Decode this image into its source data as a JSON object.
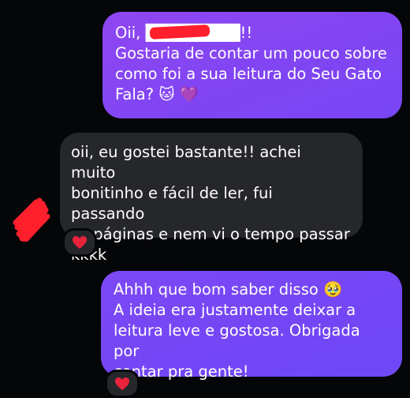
{
  "messages": [
    {
      "sender": "me",
      "text": "Oii, ████████!!\nGostaria de contar um pouco sobre\ncomo foi a sua leitura do Seu Gato\nFala? 🐱 💜"
    },
    {
      "sender": "them",
      "text": "oii, eu gostei bastante!! achei muito\nbonitinho e fácil de ler, fui passando\nas páginas e nem vi o tempo passar\nkkkk",
      "reaction": "❤️"
    },
    {
      "sender": "me",
      "text": "Ahhh que bom saber disso 🥹\nA ideia era justamente deixar a\nleitura leve e gostosa. Obrigada por\ncontar pra gente!",
      "reaction": "❤️"
    }
  ],
  "colors": {
    "background": "#050608",
    "outgoing_bubble": "#8145f3",
    "incoming_bubble": "#26272b",
    "redaction": "#ff1f2d",
    "heart": "#e8233b"
  },
  "icons": [
    "heart-reaction-icon",
    "avatar-redacted-icon"
  ]
}
